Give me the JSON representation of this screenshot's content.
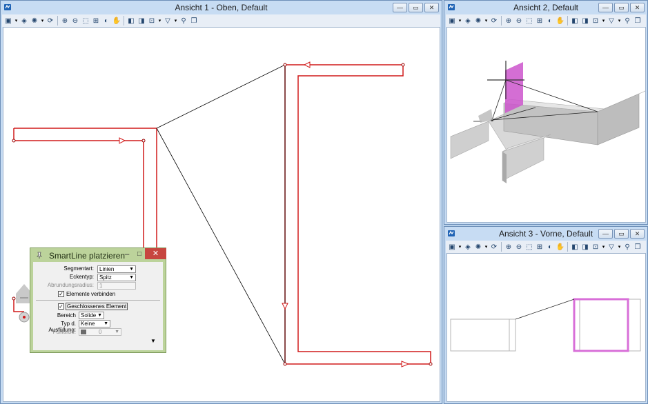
{
  "windows": {
    "view1": {
      "title": "Ansicht 1 - Oben, Default"
    },
    "view2": {
      "title": "Ansicht 2, Default"
    },
    "view3": {
      "title": "Ansicht 3 - Vorne, Default"
    }
  },
  "window_buttons": {
    "minimize": "—",
    "maximize": "▭",
    "close": "✕"
  },
  "toolbar_icons": [
    "view-attributes-icon",
    "display-style-icon",
    "lighting-icon",
    "update-icon",
    "zoom-in-icon",
    "zoom-out-icon",
    "window-area-icon",
    "fit-view-icon",
    "rotate-view-icon",
    "pan-icon",
    "view-previous-icon",
    "view-next-icon",
    "clip-volume-icon",
    "camera-icon",
    "walk-icon",
    "copy-view-icon"
  ],
  "dialog": {
    "title": "SmartLine platzieren",
    "close_glyph": "✕",
    "minimize_glyph": "–",
    "maximize_glyph": "□",
    "segmentart_label": "Segmentart:",
    "segmentart_value": "Linien",
    "eckentyp_label": "Eckentyp:",
    "eckentyp_value": "Spitz",
    "abrundungsradius_label": "Abrundungsradius:",
    "abrundungsradius_value": "1",
    "elemente_verbinden_label": "Elemente verbinden",
    "elemente_verbinden_checked": true,
    "geschlossenes_element_label": "Geschlossenes Element",
    "geschlossenes_element_checked": true,
    "bereich_label": "Bereich",
    "bereich_value": "Solide",
    "ausfuellung_label": "Typ d. Ausfüllung:",
    "ausfuellung_value": "Keine",
    "fuellfarbe_label": "Füllfarbe:",
    "fuellfarbe_value": "0",
    "check_glyph": "✓",
    "arrow_glyph": "▼"
  },
  "colors": {
    "element_red": "#d11a1a",
    "highlight_magenta": "#d86fd8",
    "dialog_green": "#bcd39b",
    "close_red": "#c7463f"
  }
}
